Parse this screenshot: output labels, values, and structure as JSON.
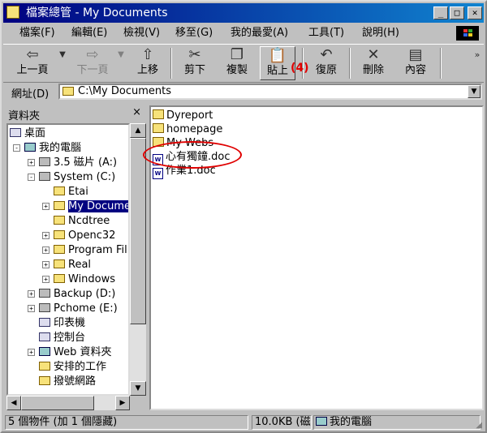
{
  "window": {
    "title": "檔案總管 - My Documents",
    "controls": [
      "_",
      "□",
      "✕"
    ]
  },
  "menu": [
    "檔案(F)",
    "編輯(E)",
    "檢視(V)",
    "移至(G)",
    "我的最愛(A)",
    "工具(T)",
    "說明(H)"
  ],
  "toolbar": {
    "back": "上一頁",
    "forward": "下一頁",
    "up": "上移",
    "cut": "剪下",
    "copy": "複製",
    "paste": "貼上",
    "undo": "復原",
    "delete": "刪除",
    "properties": "內容",
    "annotation": "(4)"
  },
  "address": {
    "label": "網址(D)",
    "value": "C:\\My Documents"
  },
  "folders_pane": {
    "title": "資料夾",
    "close": "×",
    "tree": [
      {
        "label": "桌面",
        "level": 0
      },
      {
        "label": "我的電腦",
        "level": 1
      },
      {
        "label": "3.5 磁片 (A:)",
        "level": 2
      },
      {
        "label": "System (C:)",
        "level": 2
      },
      {
        "label": "Etai",
        "level": 3
      },
      {
        "label": "My Docume",
        "level": 3,
        "selected": true
      },
      {
        "label": "Ncdtree",
        "level": 3
      },
      {
        "label": "Openc32",
        "level": 3
      },
      {
        "label": "Program Fil",
        "level": 3
      },
      {
        "label": "Real",
        "level": 3
      },
      {
        "label": "Windows",
        "level": 3
      },
      {
        "label": "Backup (D:)",
        "level": 2
      },
      {
        "label": "Pchome (E:)",
        "level": 2
      },
      {
        "label": "印表機",
        "level": 2
      },
      {
        "label": "控制台",
        "level": 2
      },
      {
        "label": "Web 資料夾",
        "level": 2
      },
      {
        "label": "安排的工作",
        "level": 2
      },
      {
        "label": "撥號網路",
        "level": 2
      }
    ]
  },
  "files": [
    {
      "name": "Dyreport",
      "type": "folder"
    },
    {
      "name": "homepage",
      "type": "folder"
    },
    {
      "name": "My Webs",
      "type": "folder"
    },
    {
      "name": "心有獨鐘.doc",
      "type": "doc"
    },
    {
      "name": "作業1.doc",
      "type": "doc"
    }
  ],
  "status": {
    "count": "5 個物件 (加 1 個隱藏)",
    "size": "10.0KB (磁",
    "location": "我的電腦"
  },
  "colors": {
    "titlebar": "#000080",
    "highlight": "#000080",
    "annotation": "#e00000",
    "folder": "#f7e27a"
  }
}
